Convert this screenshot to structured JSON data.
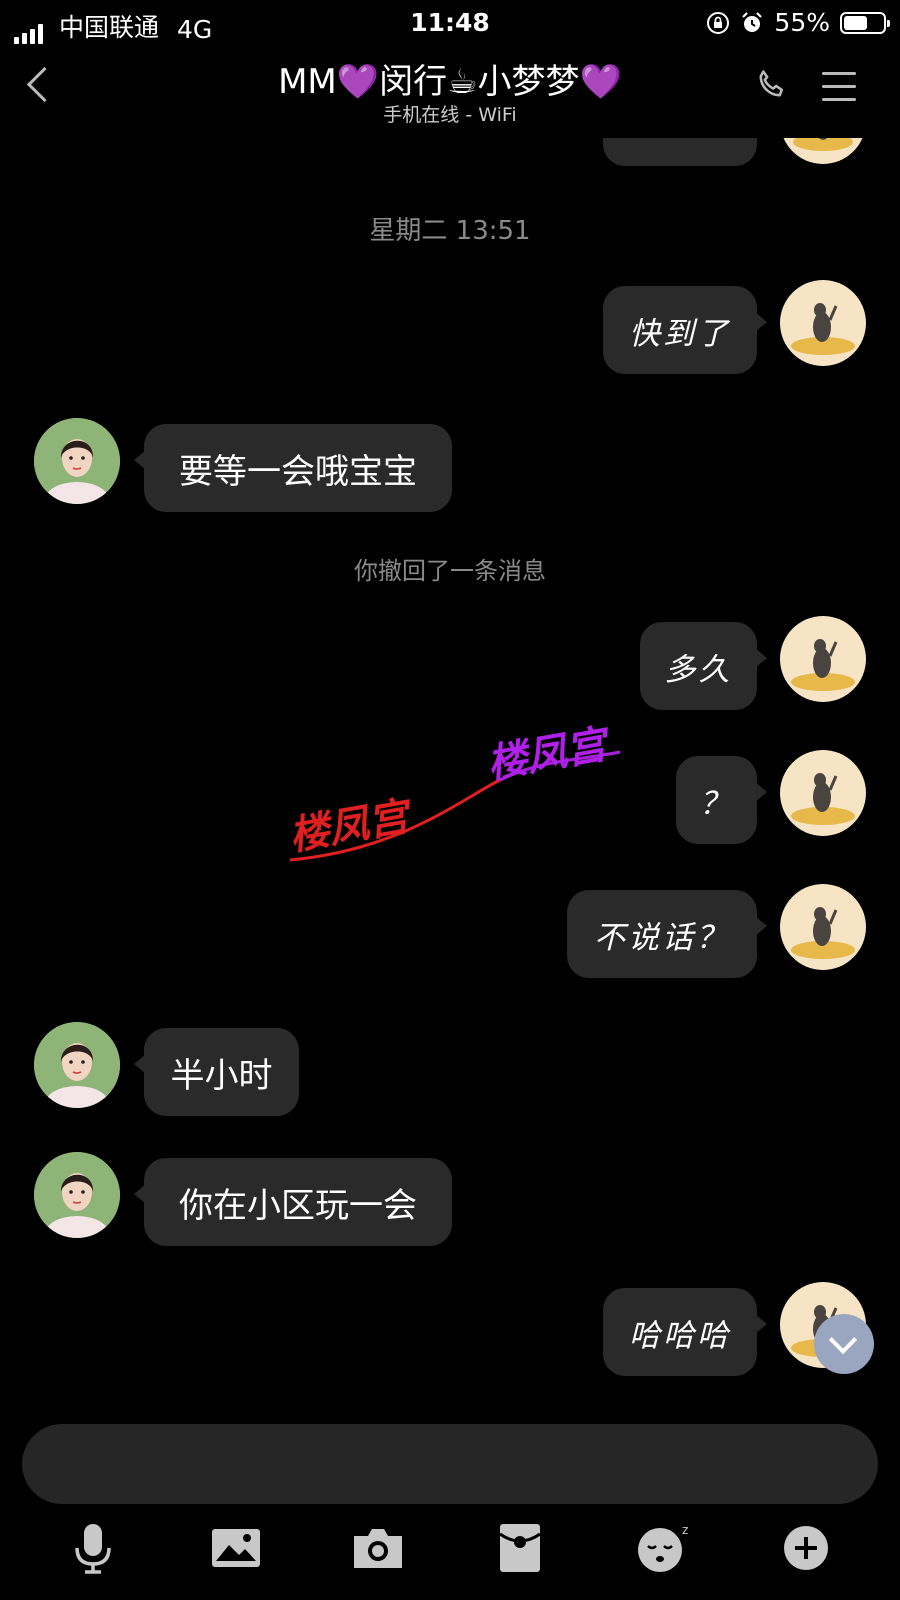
{
  "status_bar": {
    "carrier": "中国联通",
    "network": "4G",
    "time": "11:48",
    "battery": "55%",
    "battery_level": 0.55
  },
  "header": {
    "title": "MM💜闵行☕小梦梦💜",
    "subtitle": "手机在线 - WiFi"
  },
  "timestamp": "星期二 13:51",
  "messages": [
    {
      "from": "me",
      "text": "快到了"
    },
    {
      "from": "her",
      "text": "要等一会哦宝宝"
    },
    {
      "system": "你撤回了一条消息"
    },
    {
      "from": "me",
      "text": "多久"
    },
    {
      "from": "me",
      "text": "？"
    },
    {
      "from": "me",
      "text": "不说话？"
    },
    {
      "from": "her",
      "text": "半小时"
    },
    {
      "from": "her",
      "text": "你在小区玩一会"
    },
    {
      "from": "me",
      "text": "哈哈哈"
    }
  ],
  "watermark": {
    "text": "楼凤宫"
  },
  "toolbar": [
    "mic-icon",
    "image-icon",
    "camera-icon",
    "red-packet-icon",
    "emoji-icon",
    "plus-icon"
  ],
  "colors": {
    "background": "#000000",
    "bubble": "#2a2a2a",
    "accent": "#9aa6bf"
  }
}
